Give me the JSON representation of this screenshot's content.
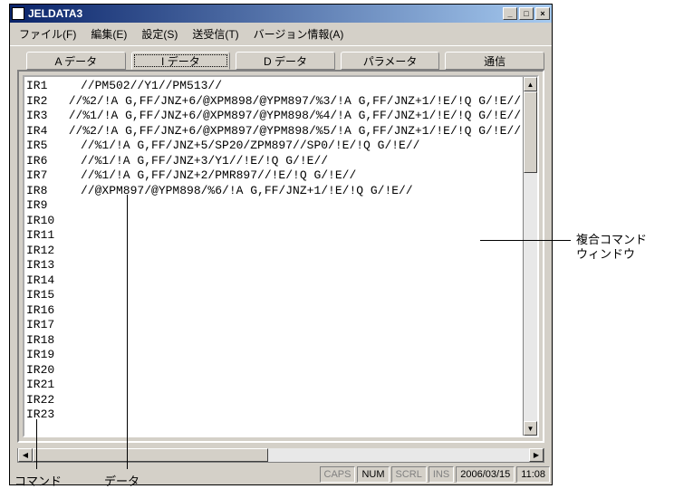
{
  "window": {
    "title": "JELDATA3"
  },
  "menu": {
    "file": "ファイル(F)",
    "edit": "編集(E)",
    "settings": "設定(S)",
    "transceive": "送受信(T)",
    "version": "バージョン情報(A)"
  },
  "tabs": {
    "a": "A データ",
    "i": "I データ",
    "d": "D データ",
    "param": "パラメータ",
    "comm": "通信",
    "active": "i"
  },
  "rows": [
    {
      "cmd": "IR1",
      "data": "//PM502//Y1//PM513//"
    },
    {
      "cmd": "IR2",
      "data": "//%2/!A G,FF/JNZ+6/@XPM898/@YPM897/%3/!A G,FF/JNZ+1/!E/!Q G/!E//"
    },
    {
      "cmd": "IR3",
      "data": "//%1/!A G,FF/JNZ+6/@XPM897/@YPM898/%4/!A G,FF/JNZ+1/!E/!Q G/!E//"
    },
    {
      "cmd": "IR4",
      "data": "//%2/!A G,FF/JNZ+6/@XPM897/@YPM898/%5/!A G,FF/JNZ+1/!E/!Q G/!E//"
    },
    {
      "cmd": "IR5",
      "data": "//%1/!A G,FF/JNZ+5/SP20/ZPM897//SP0/!E/!Q G/!E//"
    },
    {
      "cmd": "IR6",
      "data": "//%1/!A G,FF/JNZ+3/Y1//!E/!Q G/!E//"
    },
    {
      "cmd": "IR7",
      "data": "//%1/!A G,FF/JNZ+2/PMR897//!E/!Q G/!E//"
    },
    {
      "cmd": "IR8",
      "data": "//@XPM897/@YPM898/%6/!A G,FF/JNZ+1/!E/!Q G/!E//"
    },
    {
      "cmd": "IR9",
      "data": ""
    },
    {
      "cmd": "IR10",
      "data": ""
    },
    {
      "cmd": "IR11",
      "data": ""
    },
    {
      "cmd": "IR12",
      "data": ""
    },
    {
      "cmd": "IR13",
      "data": ""
    },
    {
      "cmd": "IR14",
      "data": ""
    },
    {
      "cmd": "IR15",
      "data": ""
    },
    {
      "cmd": "IR16",
      "data": ""
    },
    {
      "cmd": "IR17",
      "data": ""
    },
    {
      "cmd": "IR18",
      "data": ""
    },
    {
      "cmd": "IR19",
      "data": ""
    },
    {
      "cmd": "IR20",
      "data": ""
    },
    {
      "cmd": "IR21",
      "data": ""
    },
    {
      "cmd": "IR22",
      "data": ""
    },
    {
      "cmd": "IR23",
      "data": ""
    }
  ],
  "status": {
    "caps": "CAPS",
    "num": "NUM",
    "scrl": "SCRL",
    "ins": "INS",
    "date": "2006/03/15",
    "time": "11:08"
  },
  "callouts": {
    "compound_window_1": "複合コマンド",
    "compound_window_2": "ウィンドウ",
    "command": "コマンド",
    "data": "データ"
  }
}
